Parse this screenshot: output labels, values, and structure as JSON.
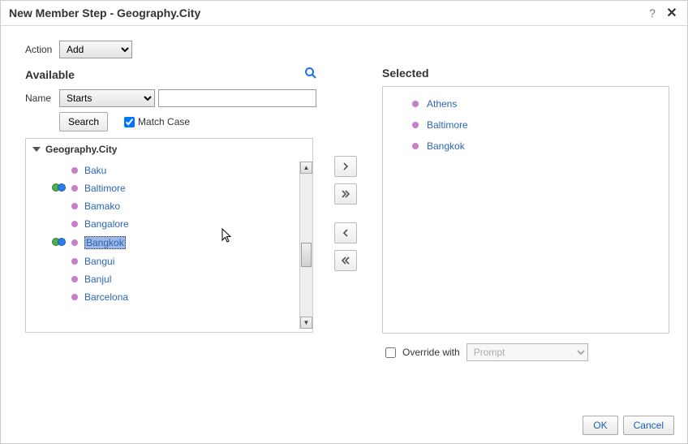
{
  "title": "New Member Step - Geography.City",
  "action": {
    "label": "Action",
    "value": "Add"
  },
  "available": {
    "header": "Available",
    "name_label": "Name",
    "name_mode": "Starts",
    "search_text": "",
    "search_button": "Search",
    "match_case_label": "Match Case",
    "match_case_checked": true,
    "tree_title": "Geography.City",
    "items": [
      {
        "label": "Baku",
        "selected": false,
        "highlight": false
      },
      {
        "label": "Baltimore",
        "selected": true,
        "highlight": false
      },
      {
        "label": "Bamako",
        "selected": false,
        "highlight": false
      },
      {
        "label": "Bangalore",
        "selected": false,
        "highlight": false
      },
      {
        "label": "Bangkok",
        "selected": true,
        "highlight": true
      },
      {
        "label": "Bangui",
        "selected": false,
        "highlight": false
      },
      {
        "label": "Banjul",
        "selected": false,
        "highlight": false
      },
      {
        "label": "Barcelona",
        "selected": false,
        "highlight": false
      }
    ]
  },
  "selected": {
    "header": "Selected",
    "items": [
      {
        "label": "Athens"
      },
      {
        "label": "Baltimore"
      },
      {
        "label": "Bangkok"
      }
    ]
  },
  "override": {
    "label": "Override with",
    "checked": false,
    "value": "Prompt"
  },
  "buttons": {
    "ok": "OK",
    "cancel": "Cancel"
  }
}
